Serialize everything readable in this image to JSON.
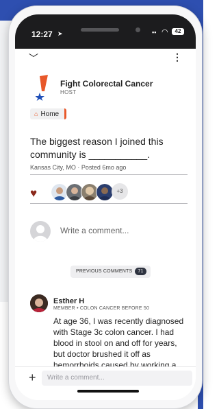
{
  "status_bar": {
    "time": "12:27",
    "battery": "42"
  },
  "host": {
    "name": "Fight Colorectal Cancer",
    "role": "HOST"
  },
  "breadcrumb": {
    "label": "Home"
  },
  "post": {
    "text": "The biggest reason I joined this community is ___________.",
    "meta": "Kansas City, MO · Posted 6mo ago",
    "reactions_more": "+3"
  },
  "comment_box": {
    "placeholder": "Write a comment..."
  },
  "previous_comments": {
    "label": "PREVIOUS COMMENTS",
    "count": "71"
  },
  "comment": {
    "author": "Esther H",
    "role": "MEMBER • COLON CANCER BEFORE 50",
    "body": "At age 36, I was recently diagnosed with Stage 3c colon cancer. I had blood in stool on and off for years, but doctor brushed it off as hemorrhoids caused by working a"
  },
  "composer": {
    "placeholder": "Write a comment..."
  },
  "colors": {
    "brand_orange": "#e8582a",
    "brand_blue": "#1f4fb8",
    "heart": "#8b2a1c"
  }
}
